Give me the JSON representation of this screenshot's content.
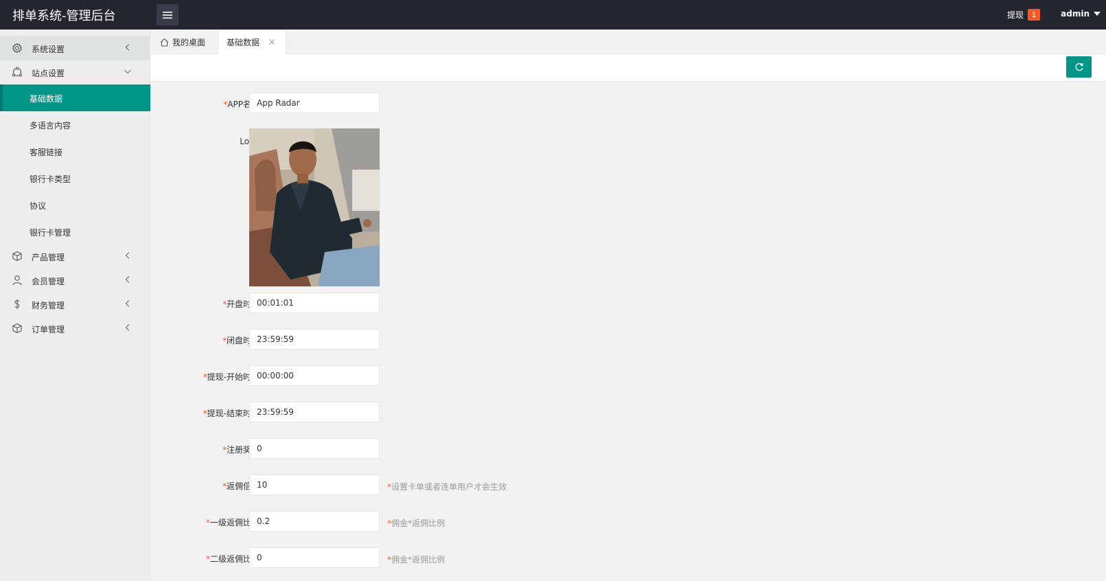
{
  "header": {
    "title": "排单系统-管理后台",
    "withdraw_label": "提现",
    "withdraw_count": "1",
    "user": "admin"
  },
  "sidebar": {
    "groups": [
      {
        "label": "系统设置",
        "icon": "gear-icon"
      },
      {
        "label": "站点设置",
        "icon": "site-icon"
      },
      {
        "label": "产品管理",
        "icon": "box-icon"
      },
      {
        "label": "会员管理",
        "icon": "user-icon"
      },
      {
        "label": "财务管理",
        "icon": "dollar-icon"
      },
      {
        "label": "订单管理",
        "icon": "box-icon"
      }
    ],
    "site_items": [
      {
        "label": "基础数据"
      },
      {
        "label": "多语言内容"
      },
      {
        "label": "客服链接"
      },
      {
        "label": "银行卡类型"
      },
      {
        "label": "协议"
      },
      {
        "label": "银行卡管理"
      }
    ]
  },
  "tabs": {
    "home": "我的桌面",
    "active": "基础数据"
  },
  "form": {
    "app_name": {
      "label": "APP名称",
      "value": "App Radar"
    },
    "logo": {
      "label": "Logo"
    },
    "open_time": {
      "label": "开盘时间",
      "value": "00:01:01"
    },
    "close_time": {
      "label": "闭盘时间",
      "value": "23:59:59"
    },
    "withdraw_start": {
      "label": "提现-开始时间",
      "value": "00:00:00"
    },
    "withdraw_end": {
      "label": "提现-结束时间",
      "value": "23:59:59"
    },
    "register_reward": {
      "label": "注册奖励",
      "value": "0"
    },
    "commission_multiple": {
      "label": "返佣倍数",
      "value": "10",
      "hint": "设置卡单或者连单用户才会生效"
    },
    "level1_ratio": {
      "label": "一级返佣比例",
      "value": "0.2",
      "hint": "佣金*返佣比例"
    },
    "level2_ratio": {
      "label": "二级返佣比例",
      "value": "0",
      "hint": "佣金*返佣比例"
    }
  },
  "colors": {
    "header_bg": "#23262e",
    "accent": "#009688",
    "required": "#ff5722",
    "badge": "#ff5722"
  }
}
